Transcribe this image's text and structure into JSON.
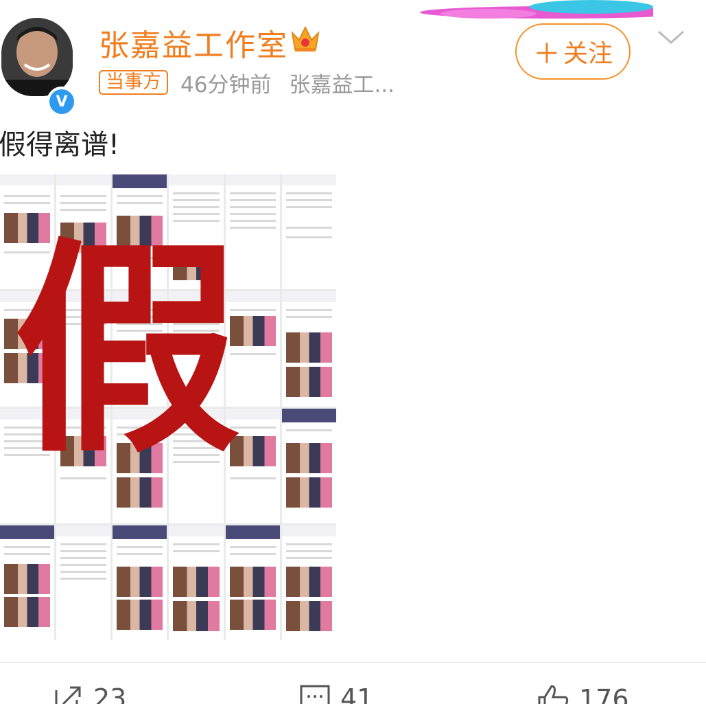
{
  "post": {
    "username": "张嘉益工作室",
    "tag": "当事方",
    "time": "46分钟前",
    "source": "张嘉益工...",
    "follow_label": "关注",
    "text": "假得离谱!",
    "image_overlay_text": "假"
  },
  "actions": {
    "repost_count": "23",
    "comment_count": "41",
    "like_count": "176"
  },
  "colors": {
    "accent": "#f07e1f",
    "verified": "#2d9af0",
    "overlay": "#b81414"
  },
  "icons": [
    "crown-icon",
    "verified-icon",
    "plus-icon",
    "chevron-down-icon",
    "repost-icon",
    "comment-icon",
    "like-icon"
  ]
}
